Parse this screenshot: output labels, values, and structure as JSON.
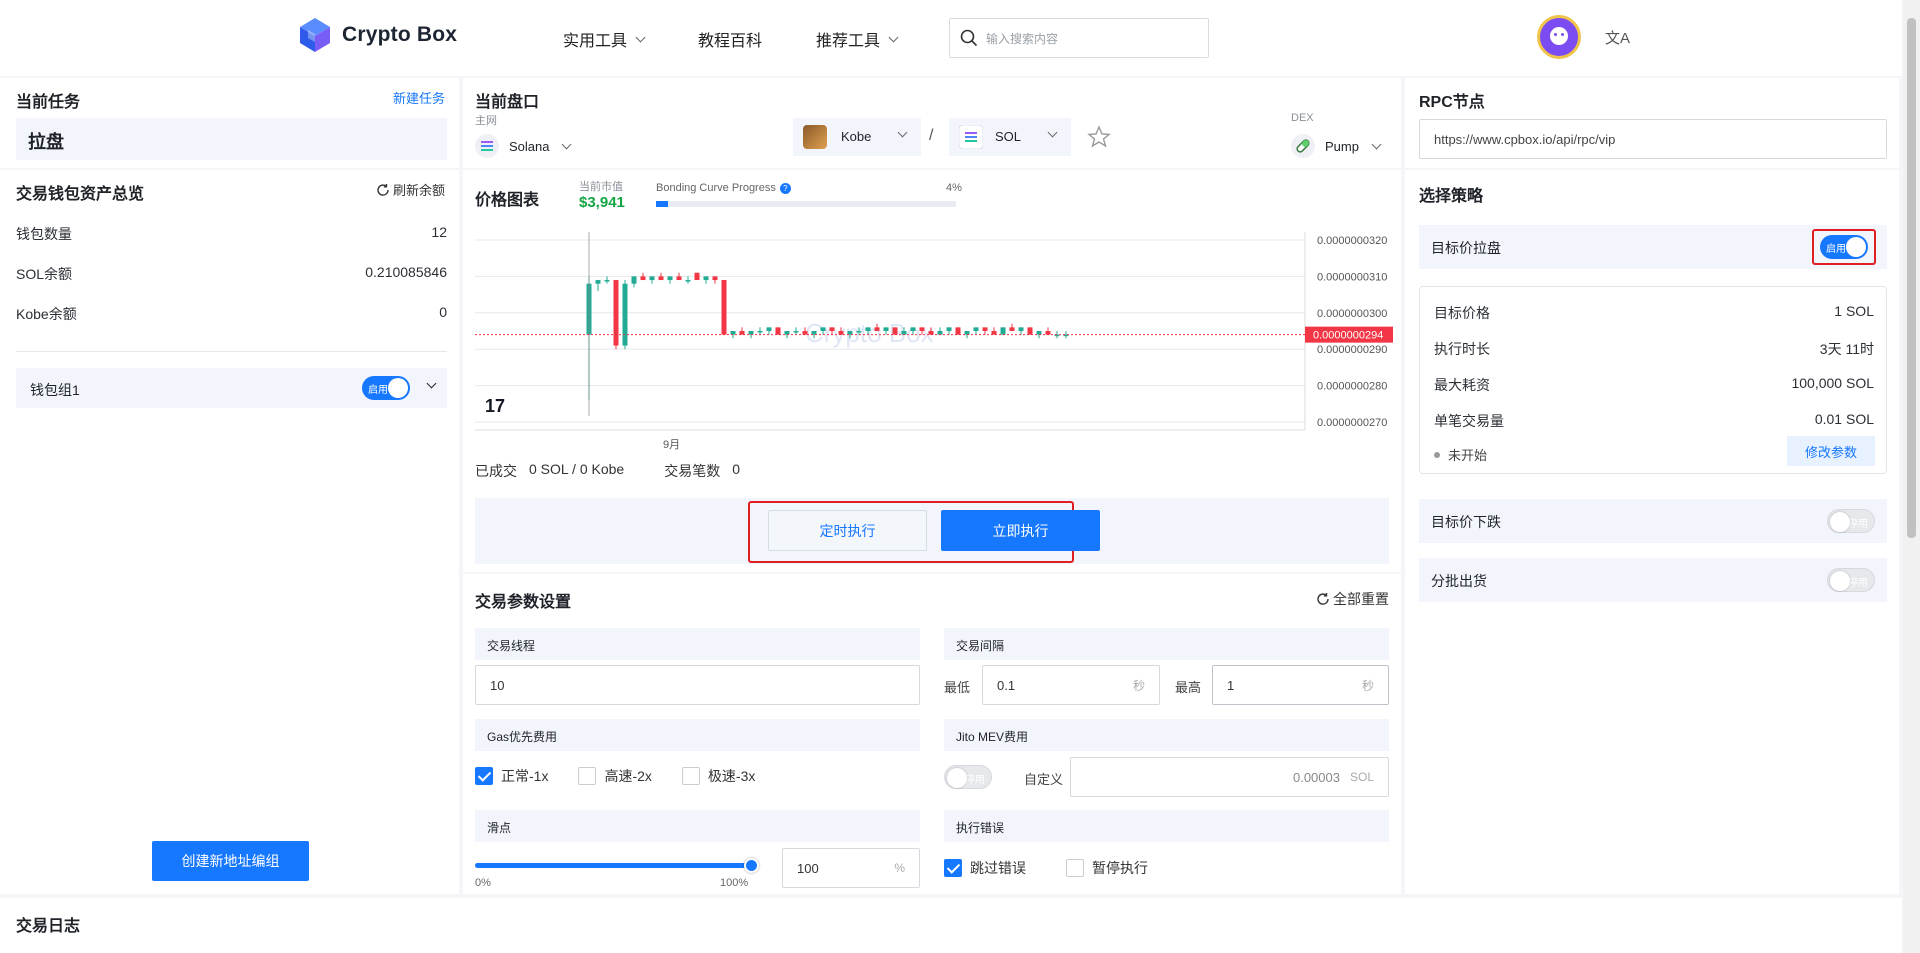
{
  "header": {
    "brand": "Crypto Box",
    "nav": [
      "实用工具",
      "教程百科",
      "推荐工具"
    ],
    "search_placeholder": "输入搜索内容"
  },
  "task": {
    "title": "当前任务",
    "new_task": "新建任务",
    "current": "拉盘"
  },
  "wallet": {
    "title": "交易钱包资产总览",
    "refresh": "刷新余额",
    "rows": [
      {
        "label": "钱包数量",
        "value": "12"
      },
      {
        "label": "SOL余额",
        "value": "0.210085846"
      },
      {
        "label": "Kobe余额",
        "value": "0"
      }
    ],
    "group_name": "钱包组1",
    "toggle_on": "启用",
    "create_button": "创建新地址编组"
  },
  "market": {
    "title": "当前盘口",
    "network_label": "主网",
    "network": "Solana",
    "token": "Kobe",
    "separator": "/",
    "quote": "SOL",
    "dex_label": "DEX",
    "dex": "Pump"
  },
  "chart_panel": {
    "title": "价格图表",
    "market_cap_label": "当前市值",
    "market_cap": "$3,941",
    "bonding_label": "Bonding Curve Progress",
    "bonding_percent_text": "4%",
    "bonding_progress": 0.04,
    "watermark": "Crypto Box",
    "done_label": "已成交",
    "done_value": "0 SOL / 0 Kobe",
    "trades_label": "交易笔数",
    "trades_value": "0",
    "schedule_button": "定时执行",
    "execute_button": "立即执行"
  },
  "chart_data": {
    "type": "candlestick",
    "xlabel": "9月",
    "y_ticks": [
      "0.0000000320",
      "0.0000000310",
      "0.0000000300",
      "0.0000000290",
      "0.0000000280",
      "0.0000000270"
    ],
    "ylim": [
      2.7e-08,
      3.2e-08
    ],
    "current_price": "0.0000000294",
    "current_price_value": 2.94e-08,
    "grid": true,
    "candles": [
      {
        "o": 2.94e-08,
        "h": 3.1e-08,
        "l": 2.76e-08,
        "c": 3.08e-08
      },
      {
        "o": 3.08e-08,
        "h": 3.09e-08,
        "l": 3.06e-08,
        "c": 3.09e-08
      },
      {
        "o": 3.09e-08,
        "h": 3.1e-08,
        "l": 3.08e-08,
        "c": 3.09e-08
      },
      {
        "o": 3.09e-08,
        "h": 3.09e-08,
        "l": 2.9e-08,
        "c": 2.91e-08
      },
      {
        "o": 2.91e-08,
        "h": 3.09e-08,
        "l": 2.9e-08,
        "c": 3.08e-08
      },
      {
        "o": 3.08e-08,
        "h": 3.1e-08,
        "l": 3.07e-08,
        "c": 3.1e-08
      },
      {
        "o": 3.1e-08,
        "h": 3.11e-08,
        "l": 3.09e-08,
        "c": 3.09e-08
      },
      {
        "o": 3.09e-08,
        "h": 3.1e-08,
        "l": 3.08e-08,
        "c": 3.1e-08
      },
      {
        "o": 3.1e-08,
        "h": 3.11e-08,
        "l": 3.09e-08,
        "c": 3.09e-08
      },
      {
        "o": 3.09e-08,
        "h": 3.1e-08,
        "l": 3.08e-08,
        "c": 3.1e-08
      },
      {
        "o": 3.1e-08,
        "h": 3.11e-08,
        "l": 3.09e-08,
        "c": 3.09e-08
      },
      {
        "o": 3.09e-08,
        "h": 3.1e-08,
        "l": 3.08e-08,
        "c": 3.09e-08
      },
      {
        "o": 3.11e-08,
        "h": 3.11e-08,
        "l": 3.09e-08,
        "c": 3.09e-08
      },
      {
        "o": 3.09e-08,
        "h": 3.1e-08,
        "l": 3.08e-08,
        "c": 3.1e-08
      },
      {
        "o": 3.1e-08,
        "h": 3.1e-08,
        "l": 3.08e-08,
        "c": 3.09e-08
      },
      {
        "o": 3.09e-08,
        "h": 3.09e-08,
        "l": 2.94e-08,
        "c": 2.94e-08
      },
      {
        "o": 2.94e-08,
        "h": 2.95e-08,
        "l": 2.93e-08,
        "c": 2.95e-08
      },
      {
        "o": 2.95e-08,
        "h": 2.96e-08,
        "l": 2.94e-08,
        "c": 2.94e-08
      },
      {
        "o": 2.94e-08,
        "h": 2.95e-08,
        "l": 2.93e-08,
        "c": 2.95e-08
      },
      {
        "o": 2.95e-08,
        "h": 2.96e-08,
        "l": 2.94e-08,
        "c": 2.95e-08
      },
      {
        "o": 2.95e-08,
        "h": 2.96e-08,
        "l": 2.94e-08,
        "c": 2.96e-08
      },
      {
        "o": 2.96e-08,
        "h": 2.96e-08,
        "l": 2.94e-08,
        "c": 2.94e-08
      },
      {
        "o": 2.94e-08,
        "h": 2.95e-08,
        "l": 2.93e-08,
        "c": 2.95e-08
      },
      {
        "o": 2.95e-08,
        "h": 2.96e-08,
        "l": 2.94e-08,
        "c": 2.95e-08
      },
      {
        "o": 2.95e-08,
        "h": 2.96e-08,
        "l": 2.94e-08,
        "c": 2.94e-08
      },
      {
        "o": 2.94e-08,
        "h": 2.95e-08,
        "l": 2.93e-08,
        "c": 2.95e-08
      },
      {
        "o": 2.95e-08,
        "h": 2.96e-08,
        "l": 2.94e-08,
        "c": 2.96e-08
      },
      {
        "o": 2.96e-08,
        "h": 2.96e-08,
        "l": 2.94e-08,
        "c": 2.95e-08
      },
      {
        "o": 2.95e-08,
        "h": 2.96e-08,
        "l": 2.94e-08,
        "c": 2.94e-08
      },
      {
        "o": 2.94e-08,
        "h": 2.95e-08,
        "l": 2.93e-08,
        "c": 2.95e-08
      },
      {
        "o": 2.95e-08,
        "h": 2.96e-08,
        "l": 2.94e-08,
        "c": 2.95e-08
      },
      {
        "o": 2.95e-08,
        "h": 2.96e-08,
        "l": 2.94e-08,
        "c": 2.96e-08
      },
      {
        "o": 2.96e-08,
        "h": 2.97e-08,
        "l": 2.95e-08,
        "c": 2.95e-08
      },
      {
        "o": 2.95e-08,
        "h": 2.96e-08,
        "l": 2.94e-08,
        "c": 2.96e-08
      },
      {
        "o": 2.96e-08,
        "h": 2.96e-08,
        "l": 2.94e-08,
        "c": 2.94e-08
      },
      {
        "o": 2.94e-08,
        "h": 2.96e-08,
        "l": 2.94e-08,
        "c": 2.95e-08
      },
      {
        "o": 2.95e-08,
        "h": 2.96e-08,
        "l": 2.94e-08,
        "c": 2.96e-08
      },
      {
        "o": 2.96e-08,
        "h": 2.96e-08,
        "l": 2.94e-08,
        "c": 2.95e-08
      },
      {
        "o": 2.95e-08,
        "h": 2.96e-08,
        "l": 2.94e-08,
        "c": 2.94e-08
      },
      {
        "o": 2.94e-08,
        "h": 2.96e-08,
        "l": 2.94e-08,
        "c": 2.95e-08
      },
      {
        "o": 2.95e-08,
        "h": 2.96e-08,
        "l": 2.94e-08,
        "c": 2.96e-08
      },
      {
        "o": 2.96e-08,
        "h": 2.96e-08,
        "l": 2.94e-08,
        "c": 2.94e-08
      },
      {
        "o": 2.94e-08,
        "h": 2.95e-08,
        "l": 2.93e-08,
        "c": 2.95e-08
      },
      {
        "o": 2.95e-08,
        "h": 2.96e-08,
        "l": 2.94e-08,
        "c": 2.96e-08
      },
      {
        "o": 2.96e-08,
        "h": 2.96e-08,
        "l": 2.94e-08,
        "c": 2.95e-08
      },
      {
        "o": 2.95e-08,
        "h": 2.96e-08,
        "l": 2.94e-08,
        "c": 2.94e-08
      },
      {
        "o": 2.94e-08,
        "h": 2.96e-08,
        "l": 2.94e-08,
        "c": 2.96e-08
      },
      {
        "o": 2.96e-08,
        "h": 2.97e-08,
        "l": 2.95e-08,
        "c": 2.95e-08
      },
      {
        "o": 2.95e-08,
        "h": 2.96e-08,
        "l": 2.94e-08,
        "c": 2.96e-08
      },
      {
        "o": 2.96e-08,
        "h": 2.96e-08,
        "l": 2.94e-08,
        "c": 2.94e-08
      },
      {
        "o": 2.94e-08,
        "h": 2.95e-08,
        "l": 2.93e-08,
        "c": 2.95e-08
      },
      {
        "o": 2.95e-08,
        "h": 2.96e-08,
        "l": 2.94e-08,
        "c": 2.94e-08
      },
      {
        "o": 2.94e-08,
        "h": 2.95e-08,
        "l": 2.93e-08,
        "c": 2.94e-08
      },
      {
        "o": 2.94e-08,
        "h": 2.95e-08,
        "l": 2.93e-08,
        "c": 2.94e-08
      }
    ]
  },
  "params": {
    "title": "交易参数设置",
    "reset_all": "全部重置",
    "threads_label": "交易线程",
    "threads_value": "10",
    "interval_label": "交易间隔",
    "min_label": "最低",
    "min_value": "0.1",
    "max_label": "最高",
    "max_value": "1",
    "sec_unit": "秒",
    "gas_label": "Gas优先费用",
    "gas_options": [
      {
        "label": "正常-1x",
        "checked": true
      },
      {
        "label": "高速-2x",
        "checked": false
      },
      {
        "label": "极速-3x",
        "checked": false
      }
    ],
    "jito_label": "Jito MEV费用",
    "jito_toggle": "停用",
    "custom_label": "自定义",
    "custom_value": "0.00003",
    "custom_unit": "SOL",
    "slippage_label": "滑点",
    "slippage_value": "100",
    "slippage_unit": "%",
    "slippage_level": 1.0,
    "slider_min": "0%",
    "slider_max": "100%",
    "error_label": "执行错误",
    "error_options": [
      {
        "label": "跳过错误",
        "checked": true
      },
      {
        "label": "暂停执行",
        "checked": false
      }
    ]
  },
  "rpc": {
    "title": "RPC节点",
    "url": "https://www.cpbox.io/api/rpc/vip"
  },
  "strategy": {
    "title": "选择策略",
    "target_pump": "目标价拉盘",
    "toggle_on": "启用",
    "toggle_off": "停用",
    "details": [
      {
        "label": "目标价格",
        "value": "1 SOL"
      },
      {
        "label": "执行时长",
        "value": "3天 11时"
      },
      {
        "label": "最大耗资",
        "value": "100,000 SOL"
      },
      {
        "label": "单笔交易量",
        "value": "0.01 SOL"
      }
    ],
    "status": "未开始",
    "modify_button": "修改参数",
    "target_drop": "目标价下跌",
    "batch_sell": "分批出货"
  },
  "log": {
    "title": "交易日志"
  }
}
